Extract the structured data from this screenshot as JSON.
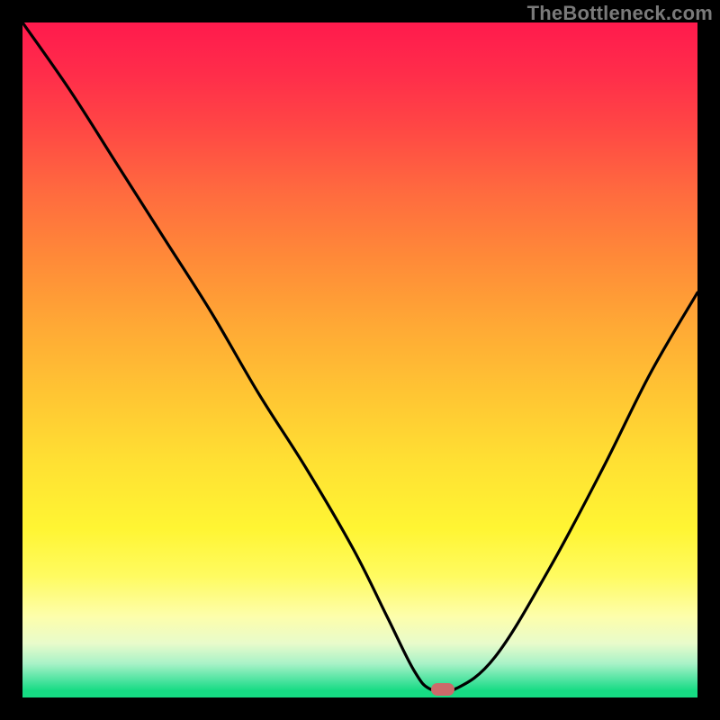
{
  "watermark": "TheBottleneck.com",
  "chart_data": {
    "type": "line",
    "title": "",
    "xlabel": "",
    "ylabel": "",
    "xlim": [
      0,
      100
    ],
    "ylim": [
      0,
      100
    ],
    "grid": false,
    "series": [
      {
        "name": "bottleneck-curve",
        "x": [
          0,
          7,
          14,
          21,
          28,
          35,
          42,
          49,
          54,
          58,
          60.5,
          64,
          70,
          78,
          86,
          93,
          100
        ],
        "values": [
          100,
          90,
          79,
          68,
          57,
          45,
          34,
          22,
          12,
          4,
          1.2,
          1.2,
          6,
          19,
          34,
          48,
          60
        ]
      }
    ],
    "marker": {
      "x": 62.2,
      "y": 1.2,
      "color": "#cc6a6a"
    },
    "gradient_stops": [
      {
        "pos": 0,
        "color": "#ff1a4d"
      },
      {
        "pos": 0.55,
        "color": "#ffc533"
      },
      {
        "pos": 0.88,
        "color": "#fdfeab"
      },
      {
        "pos": 1.0,
        "color": "#16db83"
      }
    ]
  }
}
